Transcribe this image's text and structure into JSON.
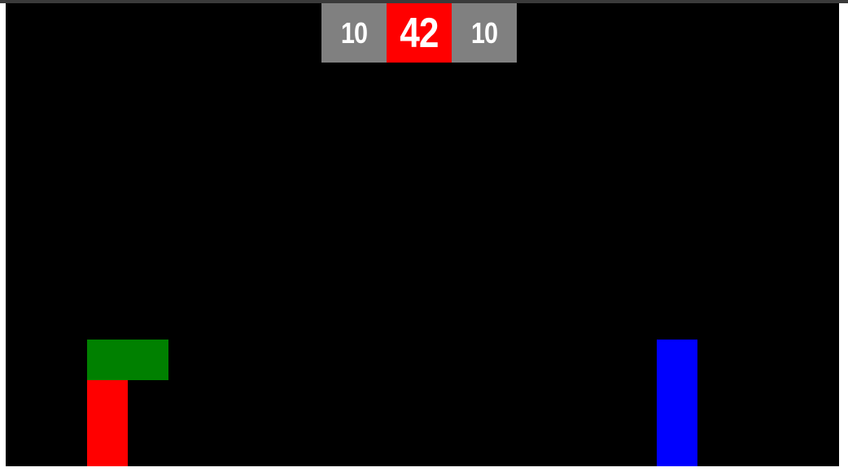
{
  "scoreboard": {
    "left_score": "10",
    "center_value": "42",
    "right_score": "10",
    "side_color": "#808080",
    "center_color": "#ff0000"
  },
  "blocks": {
    "green": {
      "color": "#008000"
    },
    "red": {
      "color": "#ff0000"
    },
    "blue": {
      "color": "#0000ff"
    }
  },
  "canvas": {
    "background": "#000000"
  }
}
